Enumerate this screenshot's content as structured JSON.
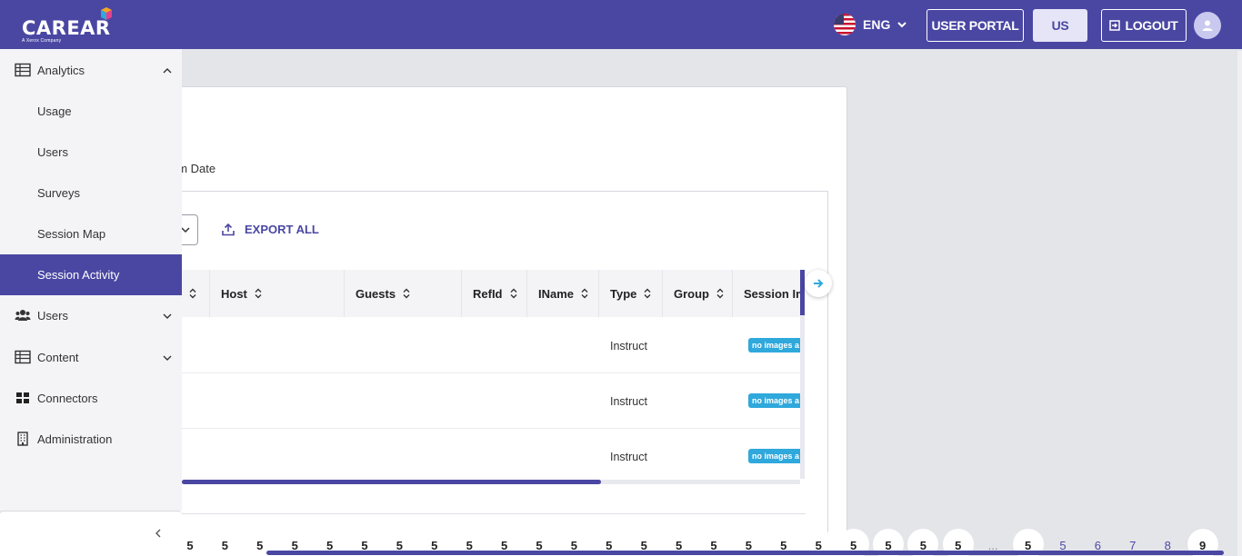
{
  "header": {
    "logo_text": "CAREAR",
    "logo_sub": "A Xerox Company",
    "language": "ENG",
    "user_portal": "USER PORTAL",
    "region": "US",
    "logout": "LOGOUT",
    "brand_color": "#4a47a3"
  },
  "sidebar": {
    "items": [
      {
        "label": "Analytics",
        "icon": "table-icon",
        "expanded": true
      },
      {
        "label": "Usage"
      },
      {
        "label": "Users"
      },
      {
        "label": "Surveys"
      },
      {
        "label": "Session Map"
      },
      {
        "label": "Session Activity",
        "active": true
      },
      {
        "label": "Users",
        "icon": "users-icon"
      },
      {
        "label": "Content",
        "icon": "table-icon"
      },
      {
        "label": "Connectors",
        "icon": "grid-icon"
      },
      {
        "label": "Administration",
        "icon": "building-icon"
      }
    ],
    "collapse": "‹"
  },
  "filters": {
    "from_date_fragment": "om Date",
    "export_all": "EXPORT ALL"
  },
  "table": {
    "columns": [
      "Host",
      "Guests",
      "RefId",
      "IName",
      "Type",
      "Group",
      "Session Im"
    ],
    "rows": [
      {
        "type": "Instruct",
        "session_images": "no images a"
      },
      {
        "type": "Instruct",
        "session_images": "no images a"
      },
      {
        "type": "Instruct",
        "session_images": "no images a"
      }
    ]
  },
  "pagination": {
    "pages": [
      "5",
      "5",
      "5",
      "5",
      "5",
      "5",
      "5",
      "5",
      "5",
      "5",
      "5",
      "5",
      "5",
      "5",
      "5",
      "5",
      "5",
      "5",
      "5",
      "5",
      "5",
      "5",
      "5",
      "...",
      "5",
      "5",
      "6",
      "7",
      "8",
      "9"
    ],
    "current": "9"
  }
}
